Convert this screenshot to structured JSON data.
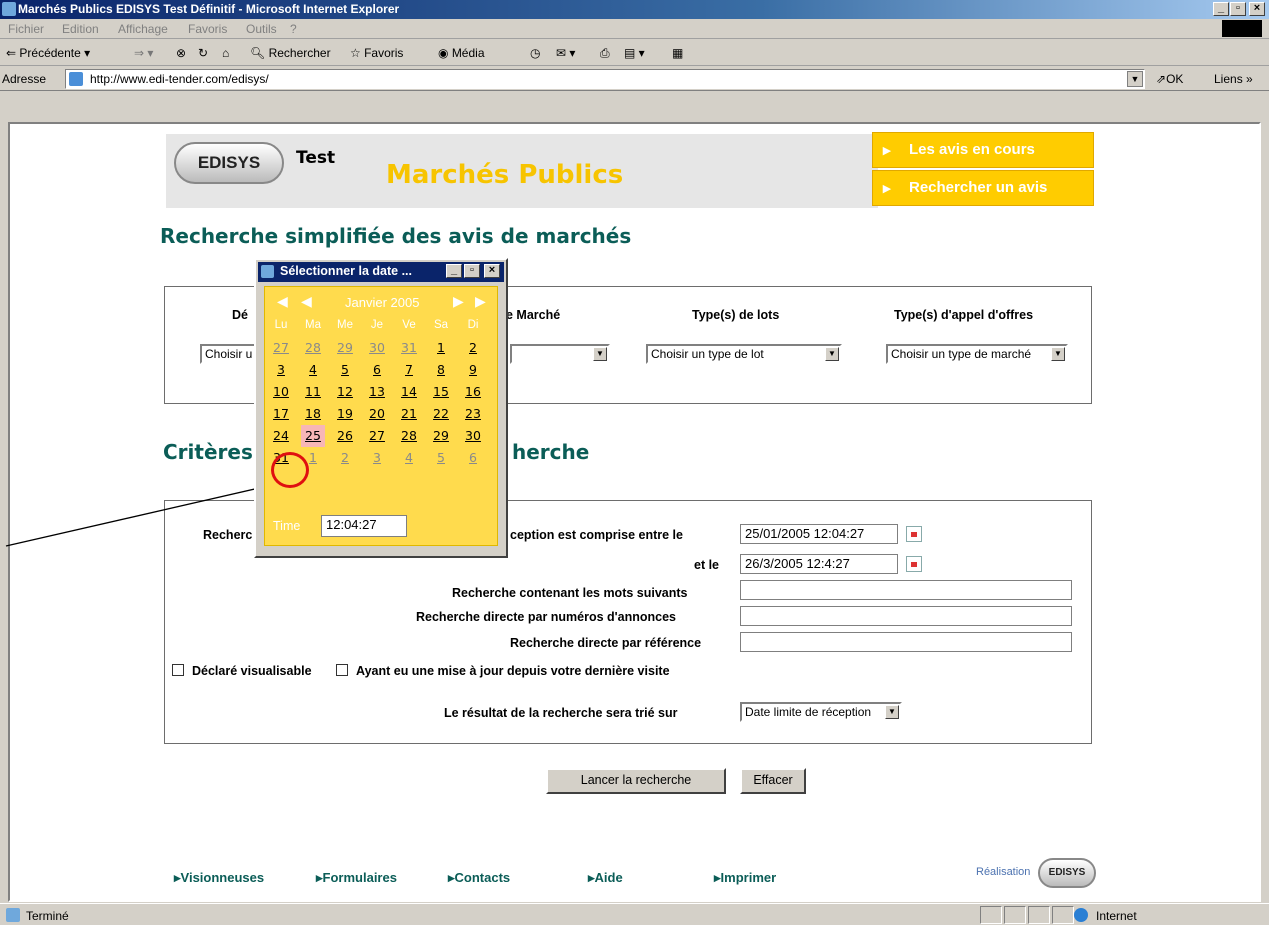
{
  "window": {
    "title": "Marchés Publics EDISYS Test Définitif - Microsoft Internet Explorer"
  },
  "menu": {
    "items": [
      "Fichier",
      "Edition",
      "Affichage",
      "Favoris",
      "Outils",
      "?"
    ]
  },
  "toolbar": {
    "back": "Précédente",
    "search": "Rechercher",
    "favorites": "Favoris",
    "media": "Média"
  },
  "address": {
    "label": "Adresse",
    "url": "http://www.edi-tender.com/edisys/",
    "go": "OK",
    "links": "Liens"
  },
  "site": {
    "logo": "EDISYS",
    "tag": "Test",
    "title": "Marchés Publics",
    "nav": [
      "Les avis en cours",
      "Rechercher un avis"
    ]
  },
  "simple_search": {
    "heading": "Recherche simplifiée des avis de marchés",
    "col1_label": "Dé",
    "col1_select": "Choisir u",
    "col2_label": "e Marché",
    "col3_label": "Type(s) de lots",
    "col3_select": "Choisir un type de lot",
    "col4_label": "Type(s) d'appel d'offres",
    "col4_select": "Choisir un type de marché"
  },
  "criteria": {
    "heading_left": "Critères",
    "heading_right": "herche",
    "row1_left": "Recherc",
    "row1_label": "ception est comprise entre le",
    "row1_value": "25/01/2005 12:04:27",
    "row2_label": "et le",
    "row2_value": "26/3/2005 12:4:27",
    "row3_label": "Recherche contenant les mots suivants",
    "row4_label": "Recherche directe par numéros d'annonces",
    "row5_label": "Recherche directe par référence",
    "check1": "Déclaré visualisable",
    "check2": "Ayant eu une mise à jour depuis votre dernière visite",
    "sort_label": "Le résultat de la recherche sera trié sur",
    "sort_value": "Date limite de réception"
  },
  "buttons": {
    "search": "Lancer la recherche",
    "clear": "Effacer"
  },
  "footer": {
    "links": [
      "Visionneuses",
      "Formulaires",
      "Contacts",
      "Aide",
      "Imprimer"
    ],
    "credit": "Réalisation",
    "credit_logo": "EDISYS"
  },
  "datepicker": {
    "title": "Sélectionner la date ...",
    "month": "Janvier 2005",
    "days": [
      "Lu",
      "Ma",
      "Me",
      "Je",
      "Ve",
      "Sa",
      "Di"
    ],
    "weeks": [
      [
        "27",
        "28",
        "29",
        "30",
        "31",
        "1",
        "2"
      ],
      [
        "3",
        "4",
        "5",
        "6",
        "7",
        "8",
        "9"
      ],
      [
        "10",
        "11",
        "12",
        "13",
        "14",
        "15",
        "16"
      ],
      [
        "17",
        "18",
        "19",
        "20",
        "21",
        "22",
        "23"
      ],
      [
        "24",
        "25",
        "26",
        "27",
        "28",
        "29",
        "30"
      ],
      [
        "31",
        "1",
        "2",
        "3",
        "4",
        "5",
        "6"
      ]
    ],
    "selected": "25",
    "time_label": "Time",
    "time_value": "12:04:27"
  },
  "status": {
    "text": "Terminé",
    "zone": "Internet"
  }
}
